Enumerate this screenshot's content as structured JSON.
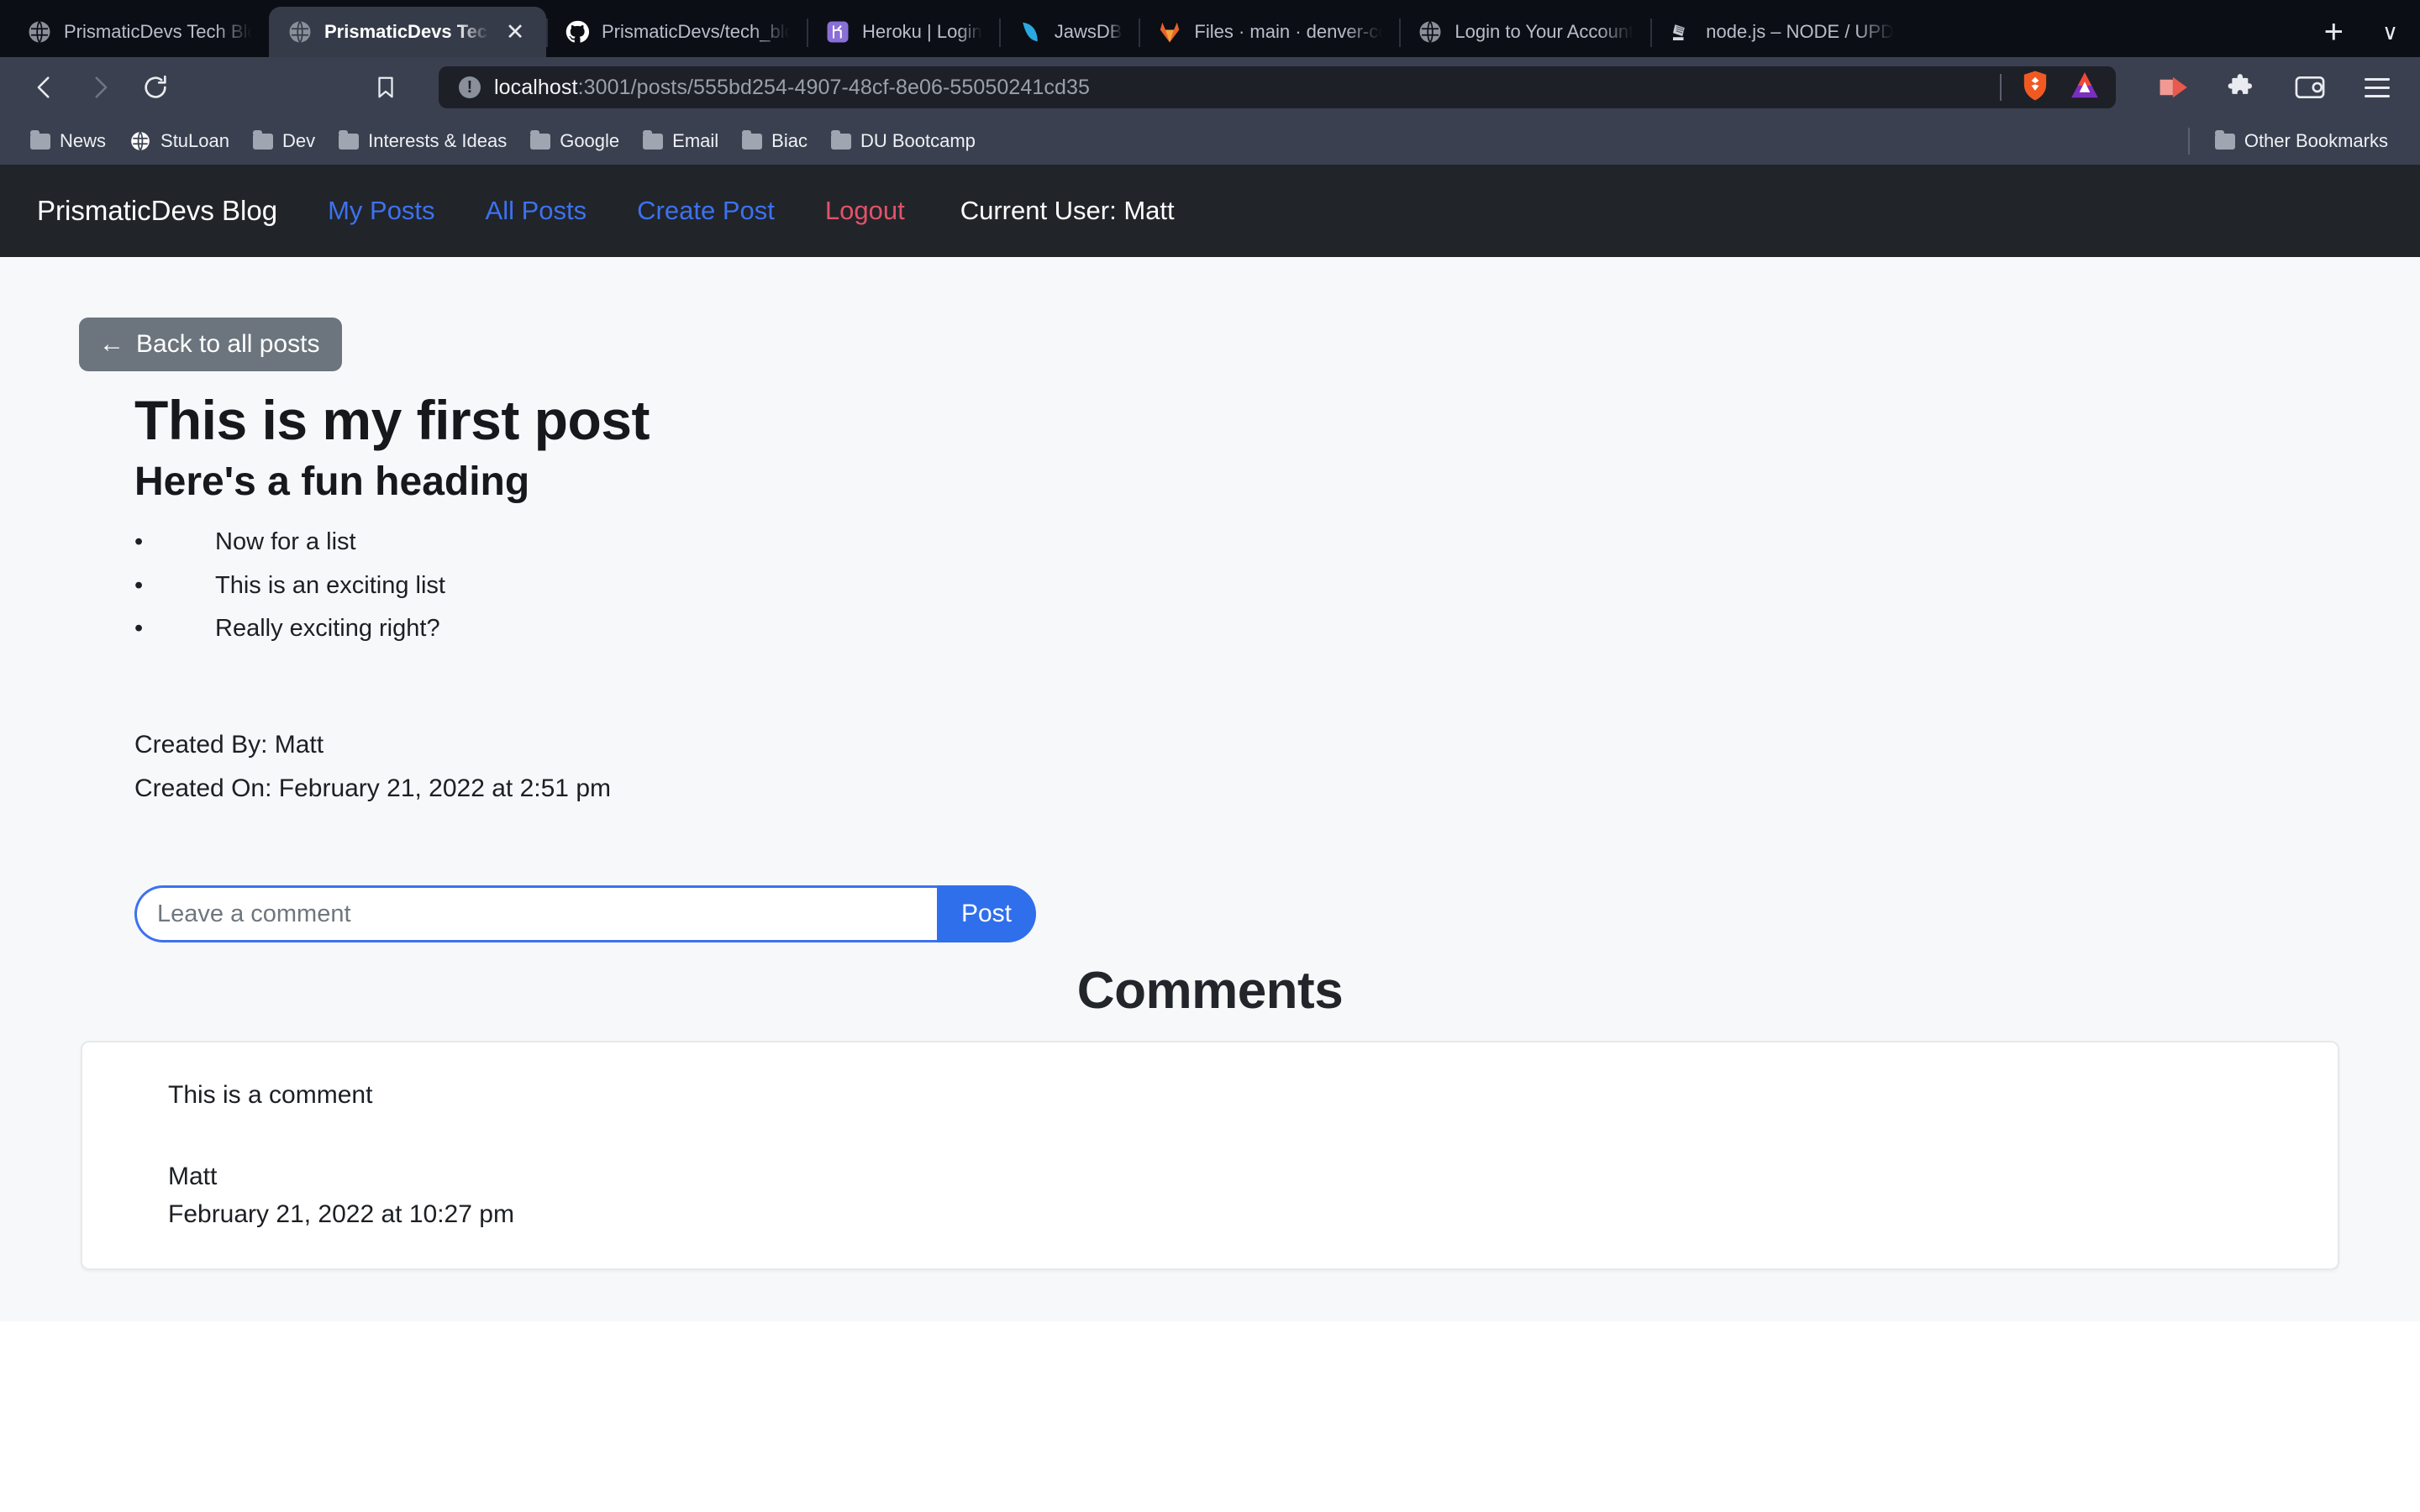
{
  "browser": {
    "tabs": [
      {
        "title": "PrismaticDevs Tech Blog",
        "icon": "globe-icon",
        "active": false
      },
      {
        "title": "PrismaticDevs Tech Blog",
        "icon": "globe-icon",
        "active": true
      },
      {
        "title": "PrismaticDevs/tech_blog",
        "icon": "github-icon",
        "active": false
      },
      {
        "title": "Heroku | Login",
        "icon": "heroku-icon",
        "active": false
      },
      {
        "title": "JawsDB",
        "icon": "jawsdb-icon",
        "active": false
      },
      {
        "title": "Files · main · denver-coding",
        "icon": "gitlab-icon",
        "active": false
      },
      {
        "title": "Login to Your Account",
        "icon": "globe-icon",
        "active": false
      },
      {
        "title": "node.js – NODE / UPDATE",
        "icon": "nodejs-icon",
        "active": false
      }
    ],
    "new_tab_label": "+",
    "tab_list_chevron": "∨",
    "toolbar": {
      "back": "◁",
      "forward": "▷",
      "reload": "⟳",
      "bookmark": "bookmark-icon",
      "url_host": "localhost",
      "url_path": ":3001/posts/555bd254-4907-48cf-8e06-55050241cd35",
      "info_glyph": "!",
      "shield_icon": "brave-shield-icon",
      "bat_icon": "brave-rewards-icon",
      "cast_icon": "cast-icon",
      "extensions_icon": "puzzle-piece-icon",
      "wallet_icon": "wallet-icon",
      "menu_icon": "hamburger-menu-icon"
    },
    "bookmarks": [
      {
        "label": "News",
        "icon": "folder-icon"
      },
      {
        "label": "StuLoan",
        "icon": "globe-icon"
      },
      {
        "label": "Dev",
        "icon": "folder-icon"
      },
      {
        "label": "Interests & Ideas",
        "icon": "folder-icon"
      },
      {
        "label": "Google",
        "icon": "folder-icon"
      },
      {
        "label": "Email",
        "icon": "folder-icon"
      },
      {
        "label": "Biac",
        "icon": "folder-icon"
      },
      {
        "label": "DU Bootcamp",
        "icon": "folder-icon"
      }
    ],
    "other_bookmarks": {
      "label": "Other Bookmarks",
      "icon": "folder-icon"
    }
  },
  "site": {
    "brand": "PrismaticDevs Blog",
    "nav": [
      {
        "label": "My Posts",
        "style": "link"
      },
      {
        "label": "All Posts",
        "style": "link"
      },
      {
        "label": "Create Post",
        "style": "link"
      },
      {
        "label": "Logout",
        "style": "danger"
      }
    ],
    "current_user": "Current User: Matt",
    "colors": {
      "navbar_bg": "#212529",
      "link": "#3d71f0",
      "danger": "#e3526a",
      "primary": "#2f6feb",
      "secondary": "#6c757d",
      "page_bg": "#f7f8fa"
    }
  },
  "post": {
    "back_button": {
      "arrow": "←",
      "label": "Back to all posts"
    },
    "title": "This is my first post",
    "heading": "Here's a fun heading",
    "list": [
      "Now for a list",
      "This is an exciting list",
      "Really exciting right?"
    ],
    "created_by": "Created By: Matt",
    "created_on": "Created On: February 21, 2022 at 2:51 pm"
  },
  "comment_form": {
    "placeholder": "Leave a comment",
    "value": "",
    "submit_label": "Post"
  },
  "comments_section": {
    "heading": "Comments",
    "items": [
      {
        "text": "This is a comment",
        "author": "Matt",
        "date": "February 21, 2022 at 10:27 pm"
      }
    ]
  }
}
